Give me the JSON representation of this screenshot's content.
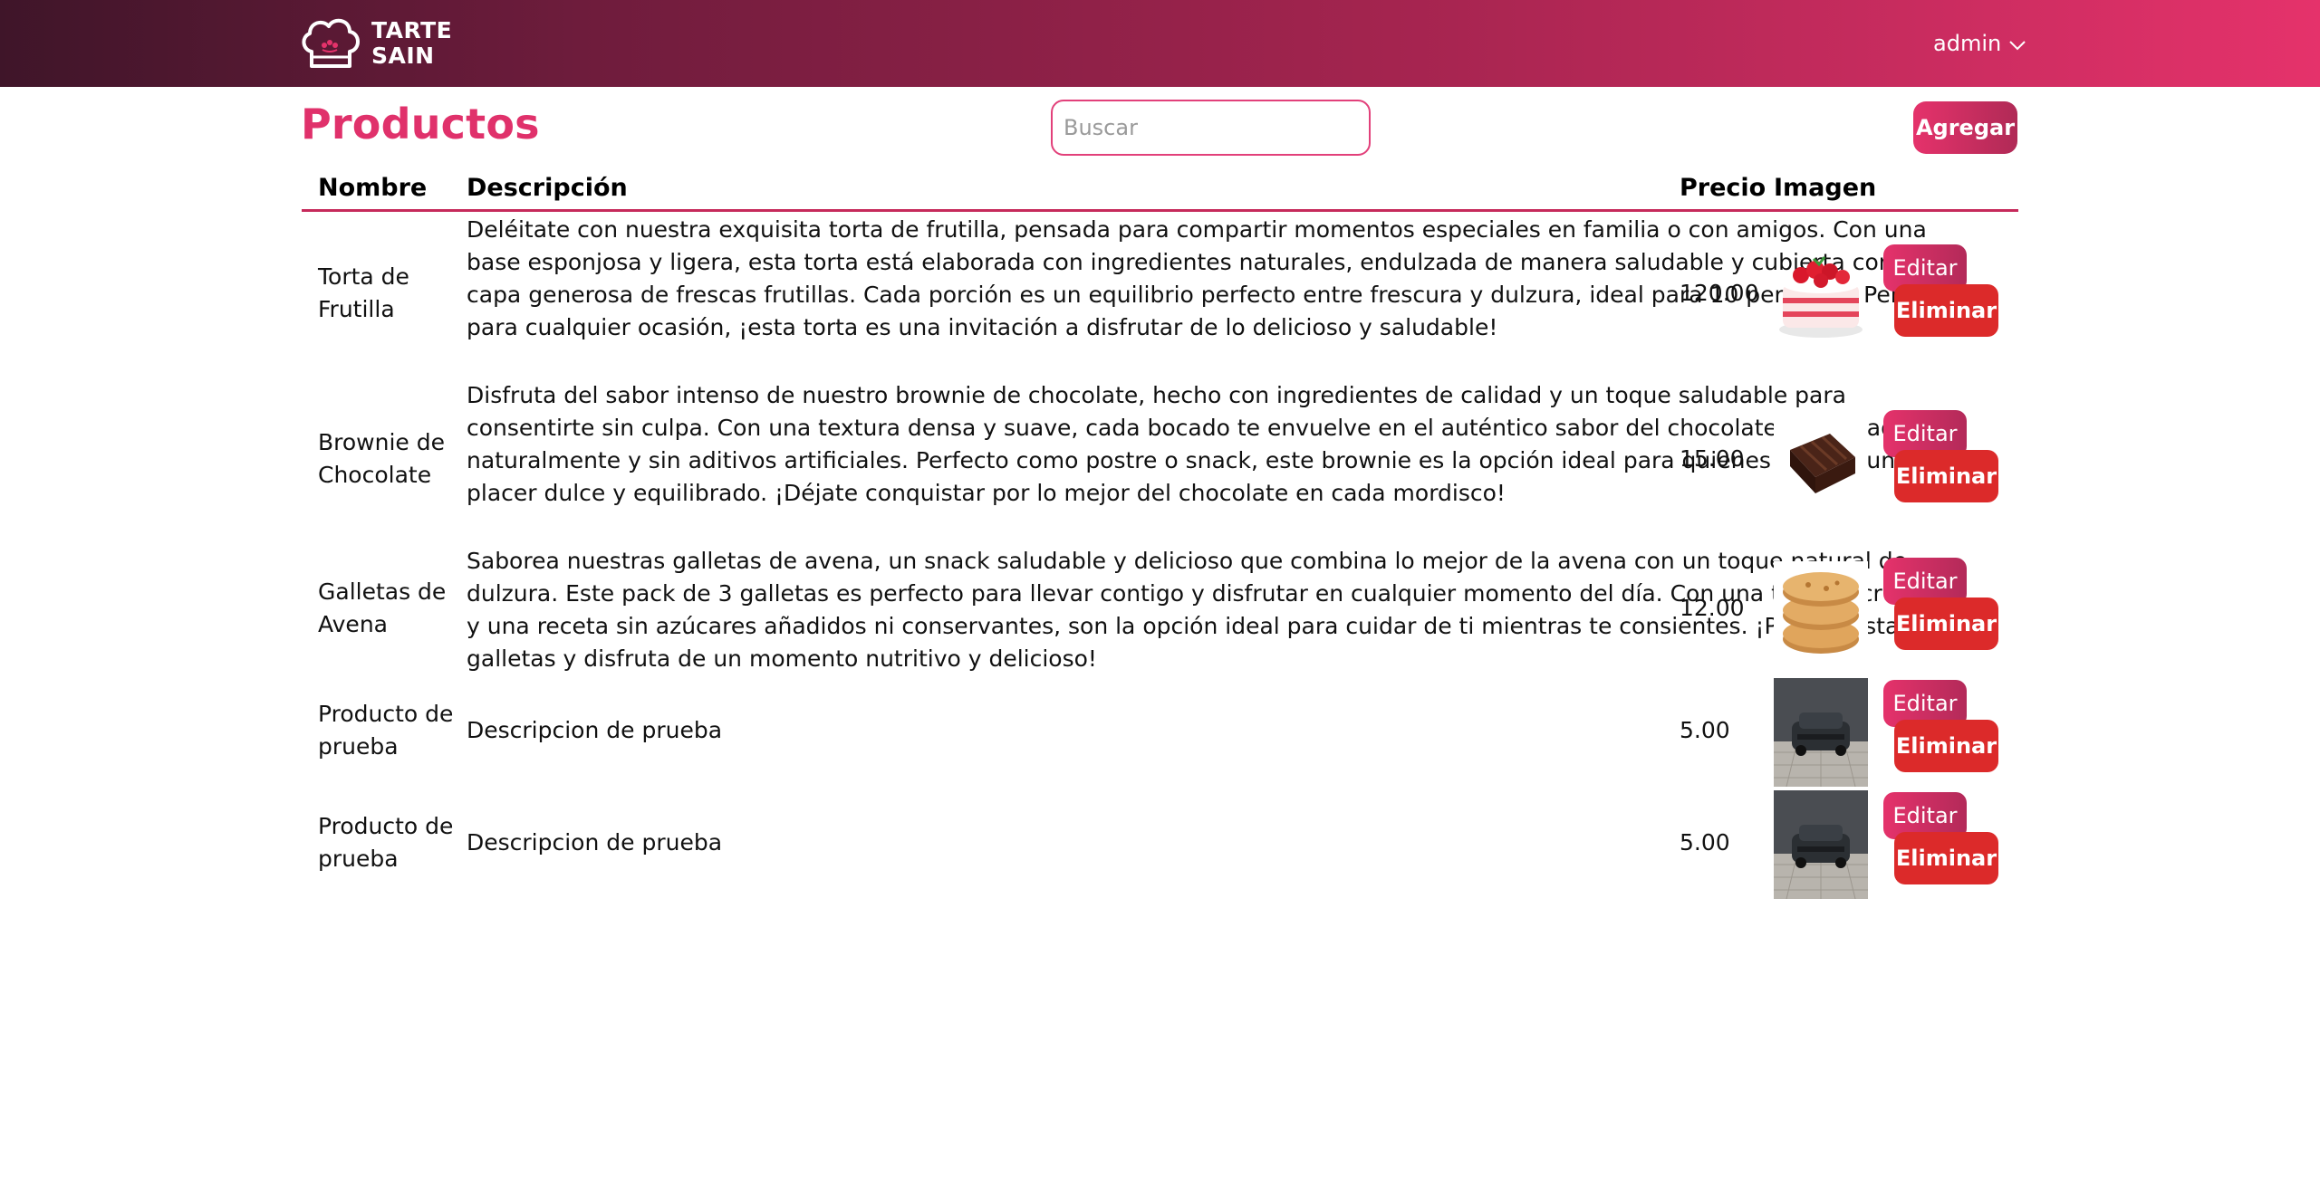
{
  "brand": {
    "logo_line1": "TARTE",
    "logo_line2": "SAIN",
    "header_gradient": [
      "#3f1529",
      "#e5326b"
    ]
  },
  "user_menu": {
    "label": "admin",
    "icon": "chevron-down-icon"
  },
  "page": {
    "title": "Productos",
    "search_placeholder": "Buscar",
    "add_label": "Agregar",
    "accent_color": "#e0316b"
  },
  "table": {
    "headers": {
      "name": "Nombre",
      "description": "Descripción",
      "price": "Precio",
      "image": "Imagen"
    },
    "edit_label": "Editar",
    "delete_label": "Eliminar",
    "rows": [
      {
        "name": "Torta de Frutilla",
        "description": "Deléitate con nuestra exquisita torta de frutilla, pensada para compartir momentos especiales en familia o con amigos. Con una base esponjosa y ligera, esta torta está elaborada con ingredientes naturales, endulzada de manera saludable y cubierta con una capa generosa de frescas frutillas. Cada porción es un equilibrio perfecto entre frescura y dulzura, ideal para 10 personas. Perfecta para cualquier ocasión, ¡esta torta es una invitación a disfrutar de lo delicioso y saludable!",
        "price": "120.00",
        "image": "strawberry-cake-image"
      },
      {
        "name": "Brownie de Chocolate",
        "description": "Disfruta del sabor intenso de nuestro brownie de chocolate, hecho con ingredientes de calidad y un toque saludable para consentirte sin culpa. Con una textura densa y suave, cada bocado te envuelve en el auténtico sabor del chocolate, endulzado naturalmente y sin aditivos artificiales. Perfecto como postre o snack, este brownie es la opción ideal para quienes buscan un placer dulce y equilibrado. ¡Déjate conquistar por lo mejor del chocolate en cada mordisco!",
        "price": "15.00",
        "image": "brownie-image"
      },
      {
        "name": "Galletas de Avena",
        "description": "Saborea nuestras galletas de avena, un snack saludable y delicioso que combina lo mejor de la avena con un toque natural de dulzura. Este pack de 3 galletas es perfecto para llevar contigo y disfrutar en cualquier momento del día. Con una textura crujiente y una receta sin azúcares añadidos ni conservantes, son la opción ideal para cuidar de ti mientras te consientes. ¡Prueba estas galletas y disfruta de un momento nutritivo y delicioso!",
        "price": "12.00",
        "image": "oat-cookies-image"
      },
      {
        "name": "Producto de prueba",
        "description": "Descripcion de prueba",
        "price": "5.00",
        "image": "car-photo-image"
      },
      {
        "name": "Producto de prueba",
        "description": "Descripcion de prueba",
        "price": "5.00",
        "image": "car-photo-image"
      }
    ]
  }
}
